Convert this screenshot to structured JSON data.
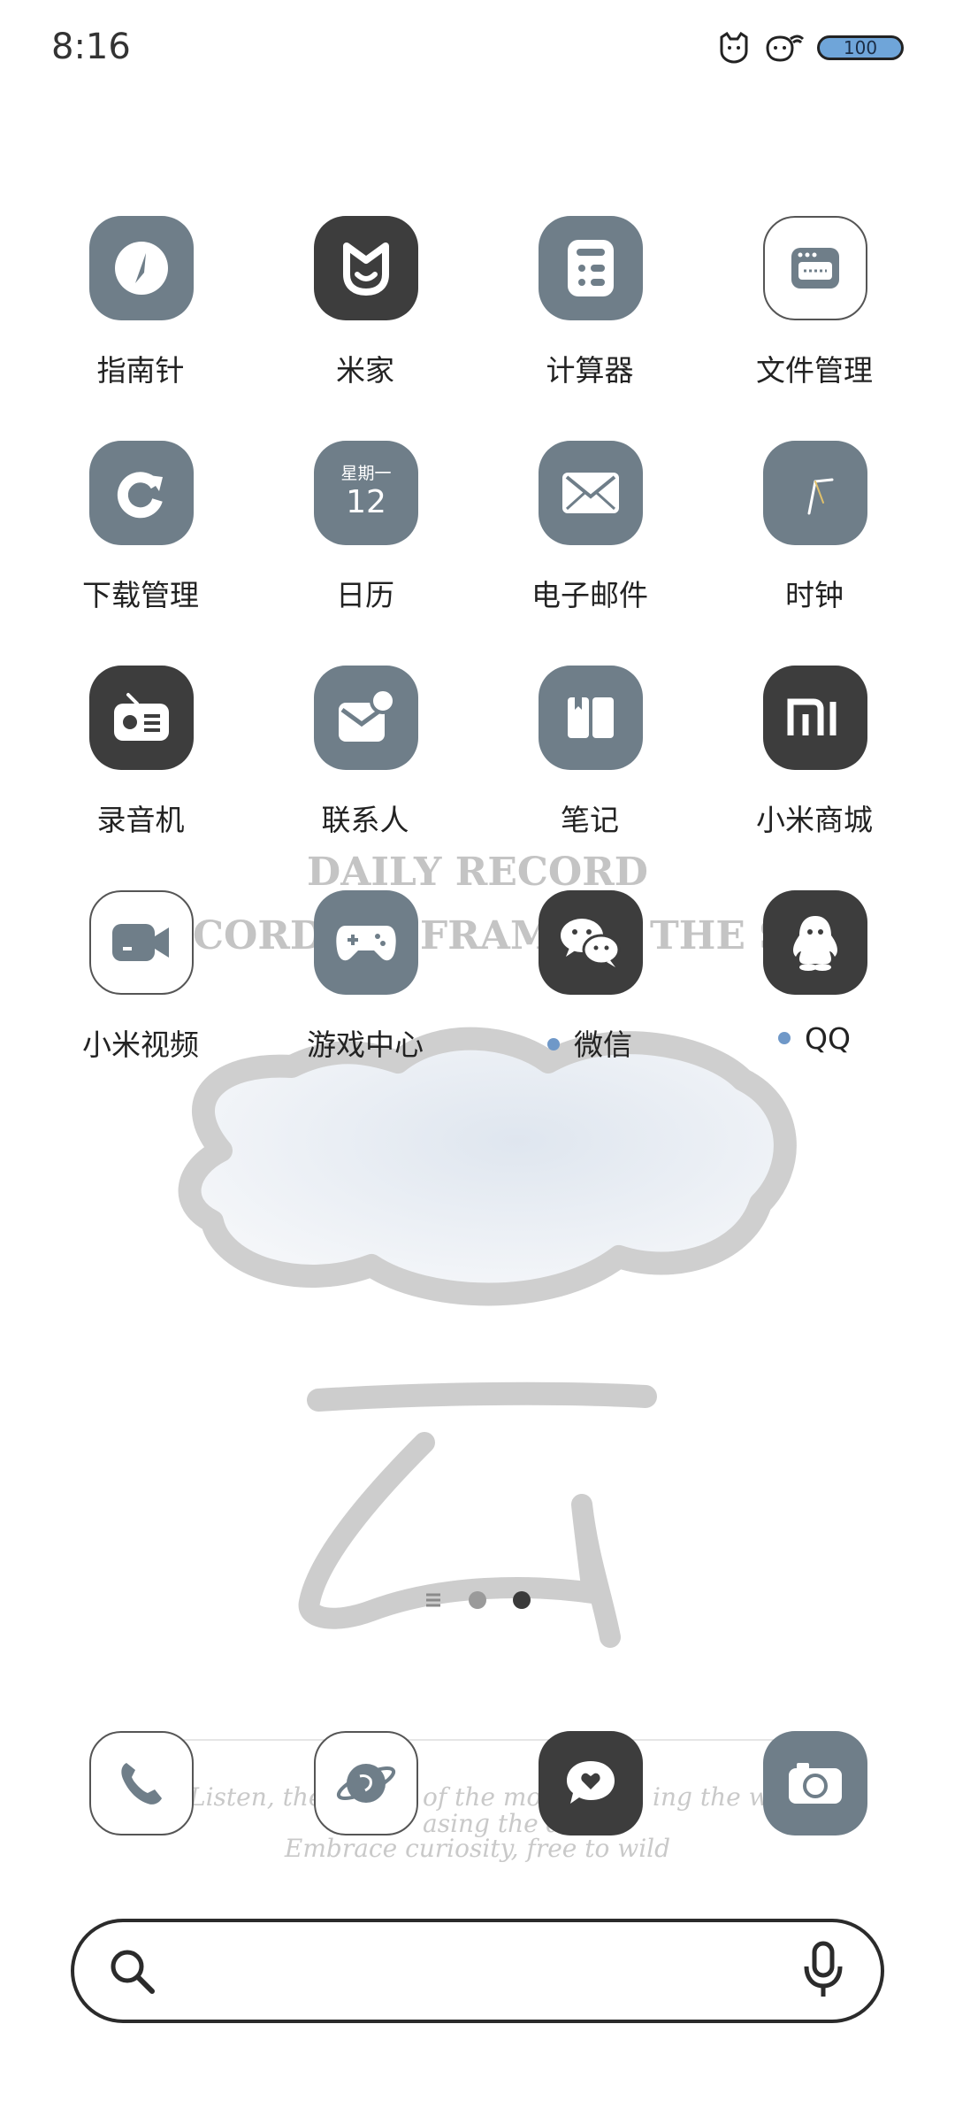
{
  "status_bar": {
    "time": "8:16",
    "battery": "100",
    "icons": [
      "notification-cat-icon",
      "wifi-cat-icon",
      "battery-icon"
    ]
  },
  "wallpaper": {
    "line1": "DAILY RECORD",
    "line2_left": "CORD",
    "line2_mid": "FRAME",
    "line2_right": "THE ST",
    "script1_left": "Listen, the g",
    "script1_mid": "of the moun",
    "script1_right": "ing the wind",
    "script2": "asing the dre",
    "script3": "Embrace curiosity, free to wild"
  },
  "apps": [
    {
      "label": "指南针",
      "icon": "compass-icon",
      "style": "gray"
    },
    {
      "label": "米家",
      "icon": "mijia-icon",
      "style": "dark"
    },
    {
      "label": "计算器",
      "icon": "calculator-icon",
      "style": "gray"
    },
    {
      "label": "文件管理",
      "icon": "file-manager-icon",
      "style": "white"
    },
    {
      "label": "下载管理",
      "icon": "download-manager-icon",
      "style": "gray"
    },
    {
      "label": "日历",
      "icon": "calendar-icon",
      "style": "gray",
      "weekday": "星期一",
      "day": "12"
    },
    {
      "label": "电子邮件",
      "icon": "email-icon",
      "style": "gray"
    },
    {
      "label": "时钟",
      "icon": "clock-icon",
      "style": "gray"
    },
    {
      "label": "录音机",
      "icon": "recorder-icon",
      "style": "dark"
    },
    {
      "label": "联系人",
      "icon": "contacts-icon",
      "style": "gray"
    },
    {
      "label": "笔记",
      "icon": "notes-icon",
      "style": "gray"
    },
    {
      "label": "小米商城",
      "icon": "mi-store-icon",
      "style": "dark"
    },
    {
      "label": "小米视频",
      "icon": "mi-video-icon",
      "style": "white"
    },
    {
      "label": "游戏中心",
      "icon": "game-center-icon",
      "style": "gray"
    },
    {
      "label": "微信",
      "icon": "wechat-icon",
      "style": "dark",
      "new_dot": true
    },
    {
      "label": "QQ",
      "icon": "qq-icon",
      "style": "dark",
      "new_dot": true
    }
  ],
  "pager": {
    "pages": 2,
    "current": 2,
    "feed_icon": "feed-lines-icon"
  },
  "dock": [
    {
      "icon": "phone-icon",
      "style": "white"
    },
    {
      "icon": "browser-icon",
      "style": "white"
    },
    {
      "icon": "messages-icon",
      "style": "dark"
    },
    {
      "icon": "camera-icon",
      "style": "gray"
    }
  ],
  "search": {
    "placeholder": "",
    "search_icon": "search-icon",
    "mic_icon": "microphone-icon"
  },
  "colors": {
    "gray_icon": "#6f7e89",
    "dark_icon": "#3d3d3d",
    "dot": "#6f98c8",
    "battery": "#6fa5d9"
  }
}
